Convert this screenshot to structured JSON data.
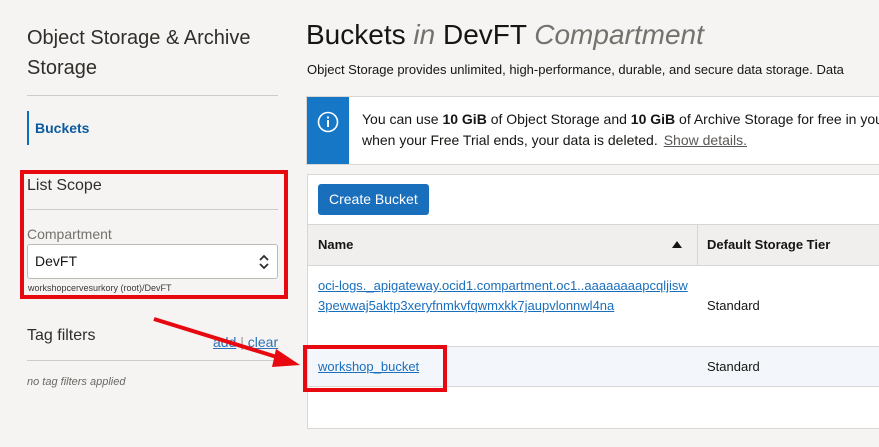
{
  "sidebar": {
    "title": "Object Storage & Archive Storage",
    "nav_items": [
      {
        "label": "Buckets",
        "active": true
      }
    ],
    "list_scope": {
      "title": "List Scope",
      "compartment_label": "Compartment",
      "compartment_value": "DevFT",
      "compartment_path": "workshopcervesurkory (root)/DevFT"
    },
    "tag_filters": {
      "title": "Tag filters",
      "add_label": "add",
      "separator": "|",
      "clear_label": "clear",
      "empty_text": "no tag filters applied"
    }
  },
  "header": {
    "title_main": "Buckets",
    "title_in": "in",
    "title_compartment": "DevFT",
    "title_suffix": "Compartment",
    "description": "Object Storage provides unlimited, high-performance, durable, and secure data storage. Data"
  },
  "banner": {
    "line1_pre": "You can use ",
    "amount1": "10 GiB",
    "line1_mid": " of Object Storage and ",
    "amount2": "10 GiB",
    "line1_post": " of Archive Storage for free in your",
    "line2": "when your Free Trial ends, your data is deleted.",
    "link": "Show details."
  },
  "toolbar": {
    "create_label": "Create Bucket"
  },
  "table": {
    "columns": [
      "Name",
      "Default Storage Tier"
    ],
    "rows": [
      {
        "name": "oci-logs._apigateway.ocid1.compartment.oc1..aaaaaaaapcqljisw3pewwaj5aktp3xeryfnmkvfqwmxkk7jaupvlonnwl4na",
        "tier": "Standard"
      },
      {
        "name": "workshop_bucket",
        "tier": "Standard"
      }
    ]
  },
  "colors": {
    "accent": "#1a6fbd",
    "info_strip": "#1577c6",
    "annotation": "#e8080f"
  }
}
